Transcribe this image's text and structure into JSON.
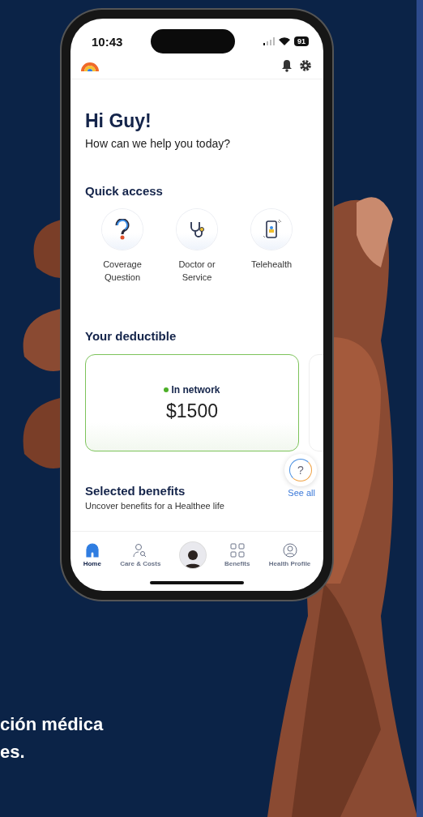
{
  "status_bar": {
    "time": "10:43",
    "battery": "91"
  },
  "greeting": {
    "title": "Hi Guy!",
    "subtitle": "How can we help you today?"
  },
  "quick_access": {
    "title": "Quick access",
    "items": [
      {
        "label": "Coverage Question",
        "kind": "question"
      },
      {
        "label": "Doctor or Service",
        "kind": "stethoscope"
      },
      {
        "label": "Telehealth",
        "kind": "phone"
      }
    ]
  },
  "deductible": {
    "title": "Your deductible",
    "cards": [
      {
        "status": "In network",
        "color": "#4caf28",
        "amount": "$1500"
      }
    ]
  },
  "help_button": {
    "label": "?"
  },
  "benefits": {
    "title": "Selected benefits",
    "link": "See all",
    "subtitle": "Uncover benefits for a Healthee life"
  },
  "nav": [
    {
      "kind": "home",
      "label": "Home",
      "selected": true
    },
    {
      "kind": "care",
      "label": "Care & Costs",
      "selected": false
    },
    {
      "kind": "avatar",
      "selected": false
    },
    {
      "kind": "benefits",
      "label": "Benefits",
      "selected": false
    },
    {
      "kind": "profile",
      "label": "Health Profile",
      "selected": false
    }
  ],
  "poster_text": [
    "ción médica",
    "es."
  ]
}
